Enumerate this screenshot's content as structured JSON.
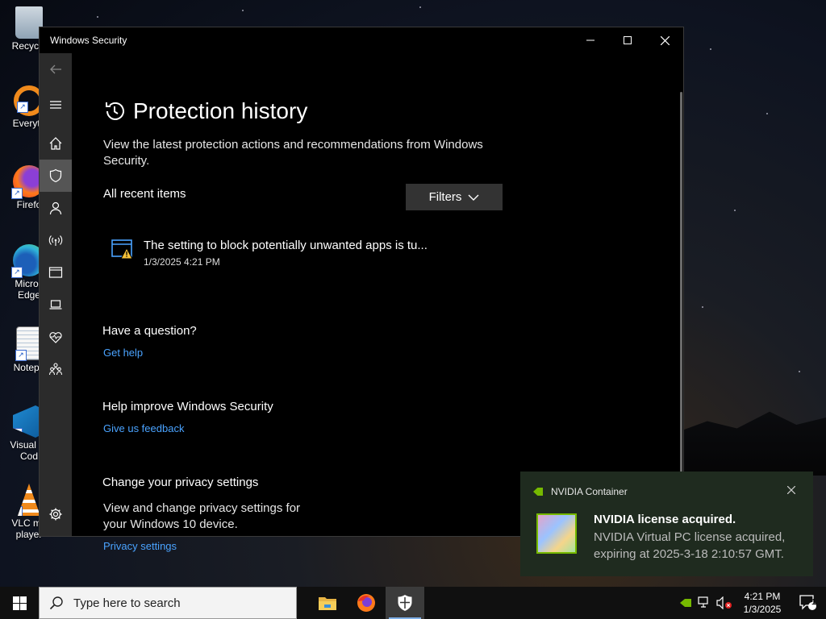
{
  "desktop": {
    "icons": [
      {
        "label": "Recycle",
        "icon": "recycle-bin-icon"
      },
      {
        "label": "Everyth",
        "icon": "everything-search-icon"
      },
      {
        "label": "Firefo",
        "icon": "firefox-icon"
      },
      {
        "label": "Micros\nEdge",
        "icon": "edge-icon"
      },
      {
        "label": "Notepa",
        "icon": "notepad-icon"
      },
      {
        "label": "Visual St\nCod",
        "icon": "vscode-icon"
      },
      {
        "label": "VLC me\nplayer",
        "icon": "vlc-icon"
      }
    ]
  },
  "window": {
    "title": "Windows Security",
    "controls": {
      "minimize": "minimize-icon",
      "maximize": "maximize-icon",
      "close": "close-icon"
    }
  },
  "sidebar": {
    "items": [
      {
        "name": "back",
        "icon": "back-arrow-icon"
      },
      {
        "name": "menu",
        "icon": "hamburger-icon"
      },
      {
        "name": "home",
        "icon": "home-icon"
      },
      {
        "name": "virus-protection",
        "icon": "shield-icon",
        "active": true
      },
      {
        "name": "account-protection",
        "icon": "person-icon"
      },
      {
        "name": "firewall-network",
        "icon": "wifi-antenna-icon"
      },
      {
        "name": "app-browser-control",
        "icon": "browser-window-icon"
      },
      {
        "name": "device-security",
        "icon": "laptop-icon"
      },
      {
        "name": "device-performance",
        "icon": "heart-pulse-icon"
      },
      {
        "name": "family-options",
        "icon": "family-icon"
      },
      {
        "name": "settings",
        "icon": "gear-icon"
      }
    ]
  },
  "page": {
    "title": "Protection history",
    "description": "View the latest protection actions and recommendations from Windows Security.",
    "list_header": "All recent items",
    "filters_label": "Filters",
    "items": [
      {
        "title": "The setting to block potentially unwanted apps is tu...",
        "date": "1/3/2025 4:21 PM",
        "icon": "warning-window-icon"
      }
    ],
    "question": {
      "heading": "Have a question?",
      "link": "Get help"
    },
    "improve": {
      "heading": "Help improve Windows Security",
      "link": "Give us feedback"
    },
    "privacy": {
      "heading": "Change your privacy settings",
      "text": "View and change privacy settings for your Windows 10 device.",
      "link": "Privacy settings"
    }
  },
  "toast": {
    "app": "NVIDIA Container",
    "title": "NVIDIA license acquired.",
    "body": "NVIDIA Virtual PC license acquired, expiring at 2025-3-18 2:10:57 GMT."
  },
  "taskbar": {
    "search_placeholder": "Type here to search",
    "apps": [
      {
        "name": "file-explorer",
        "icon": "folder-icon"
      },
      {
        "name": "firefox",
        "icon": "firefox-icon"
      },
      {
        "name": "windows-security",
        "icon": "shield-icon",
        "running": true
      }
    ],
    "time": "4:21 PM",
    "date": "1/3/2025",
    "notification_count": "1"
  }
}
